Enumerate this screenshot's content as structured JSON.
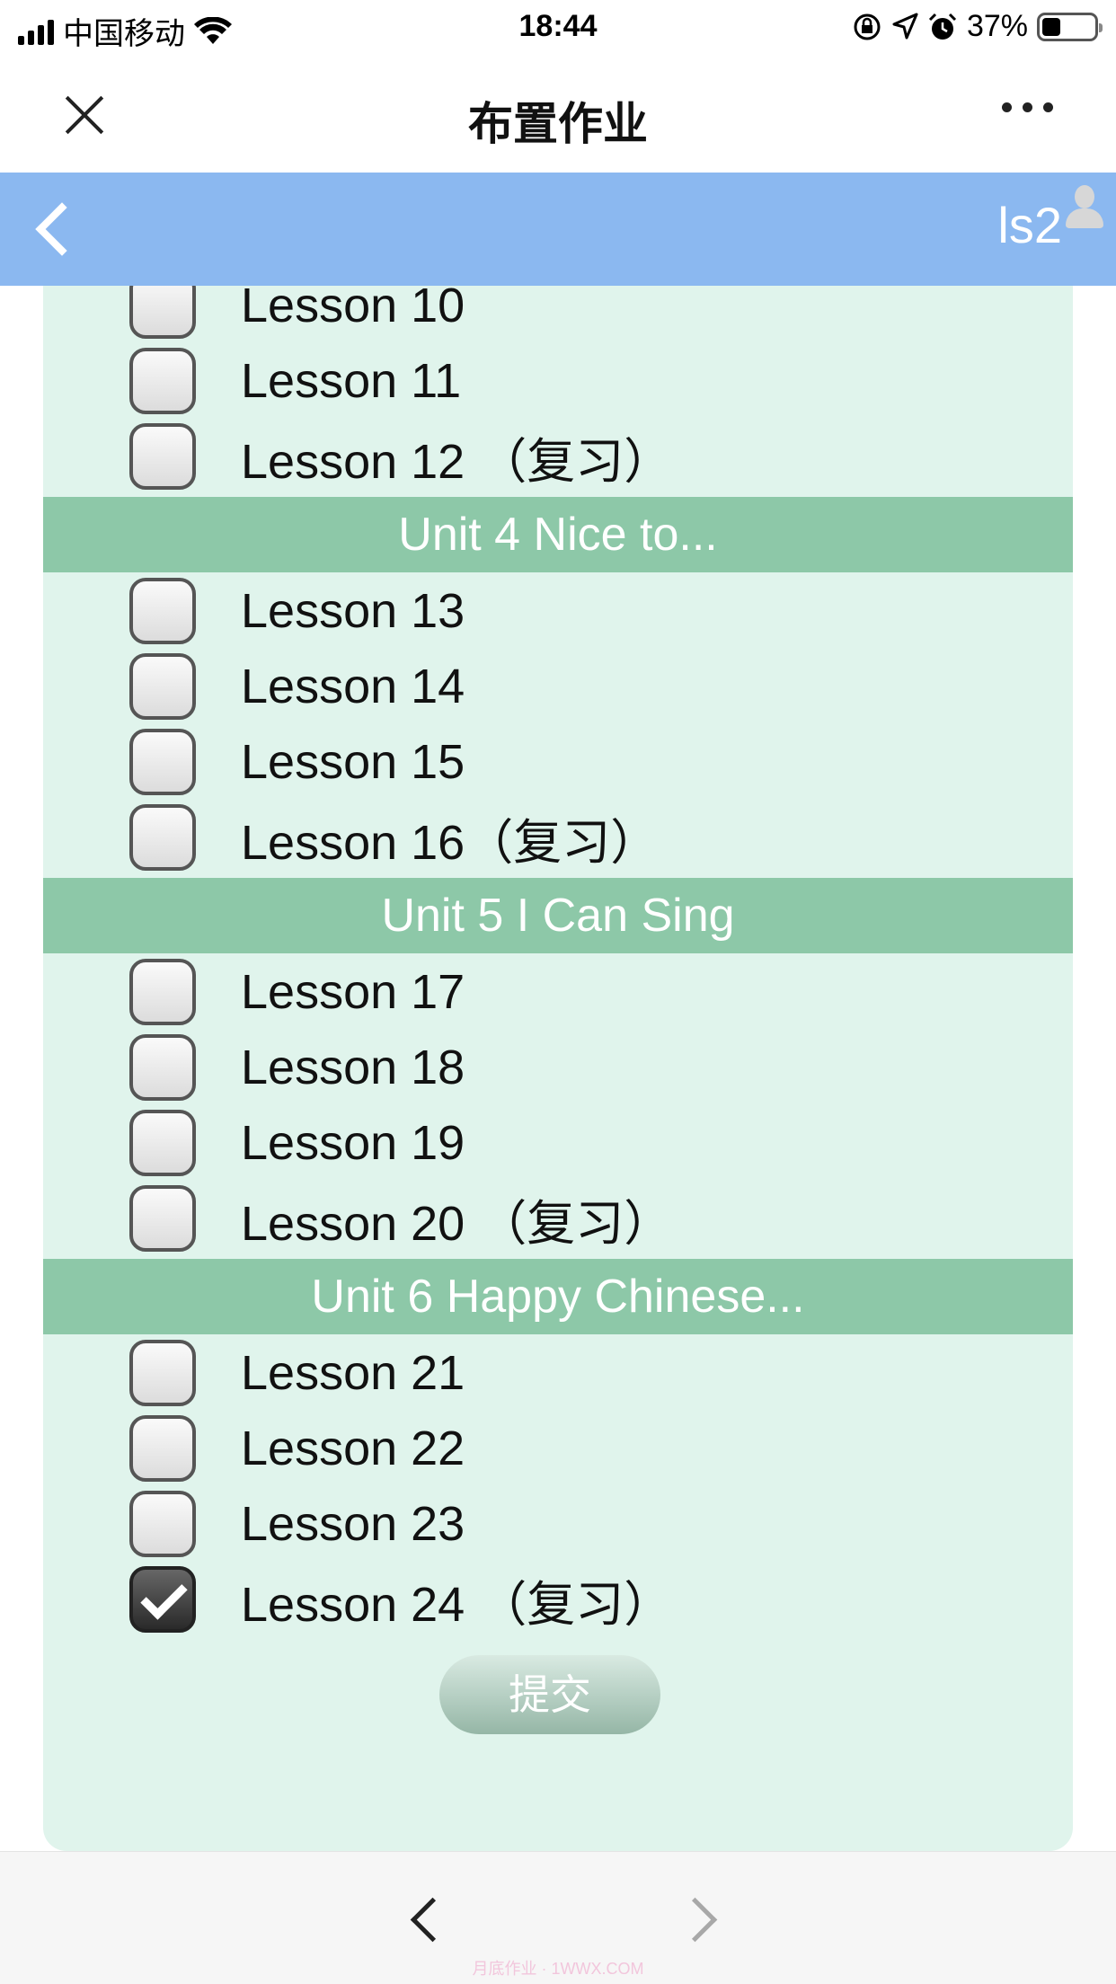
{
  "status_bar": {
    "carrier": "中国移动",
    "time": "18:44",
    "battery": "37%",
    "battery_level": 0.37
  },
  "top_nav": {
    "title": "布置作业"
  },
  "header": {
    "user": "ls2"
  },
  "lessons_top": [
    {
      "label": "Lesson 10",
      "checked": false
    },
    {
      "label": "Lesson 11",
      "checked": false
    },
    {
      "label": "Lesson 12 （复习）",
      "checked": false
    }
  ],
  "units": [
    {
      "title": "Unit 4 Nice to...",
      "lessons": [
        {
          "label": "Lesson 13",
          "checked": false
        },
        {
          "label": "Lesson 14",
          "checked": false
        },
        {
          "label": "Lesson 15",
          "checked": false
        },
        {
          "label": "Lesson 16（复习）",
          "checked": false
        }
      ]
    },
    {
      "title": "Unit 5 I Can Sing",
      "lessons": [
        {
          "label": "Lesson 17",
          "checked": false
        },
        {
          "label": "Lesson 18",
          "checked": false
        },
        {
          "label": "Lesson 19",
          "checked": false
        },
        {
          "label": "Lesson 20 （复习）",
          "checked": false
        }
      ]
    },
    {
      "title": "Unit 6 Happy Chinese...",
      "lessons": [
        {
          "label": "Lesson 21",
          "checked": false
        },
        {
          "label": "Lesson 22",
          "checked": false
        },
        {
          "label": "Lesson 23",
          "checked": false
        },
        {
          "label": "Lesson 24 （复习）",
          "checked": true
        }
      ]
    }
  ],
  "submit_label": "提交",
  "watermark": "月底作业 · 1WWX.COM",
  "colors": {
    "header_blue": "#8bb8f0",
    "unit_green": "#8dc8a8",
    "panel_bg": "#e0f4ec"
  }
}
